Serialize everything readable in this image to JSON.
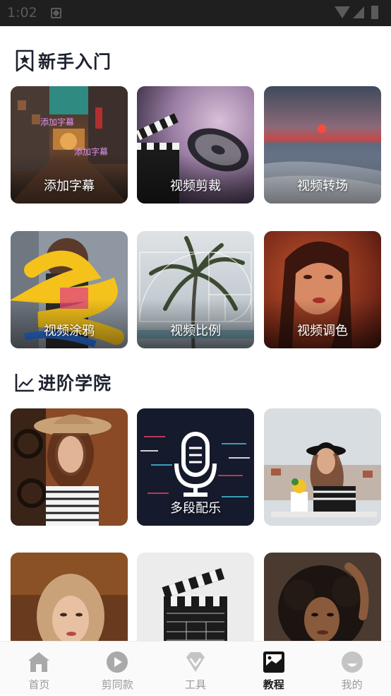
{
  "status_bar": {
    "time": "1:02"
  },
  "sections": {
    "beginner": {
      "title": "新手入门",
      "cards": [
        "添加字幕",
        "视频剪裁",
        "视频转场",
        "视频涂鸦",
        "视频比例",
        "视频调色"
      ],
      "overlay_text": [
        "添加字幕",
        "添加字幕"
      ]
    },
    "advanced": {
      "title": "进阶学院",
      "cards": [
        "",
        "多段配乐",
        "",
        "",
        "",
        ""
      ]
    }
  },
  "bottom_nav": {
    "items": [
      {
        "label": "首页",
        "icon": "home-icon"
      },
      {
        "label": "剪同款",
        "icon": "play-icon"
      },
      {
        "label": "工具",
        "icon": "diamond-icon"
      },
      {
        "label": "教程",
        "icon": "picture-icon"
      },
      {
        "label": "我的",
        "icon": "profile-icon"
      }
    ],
    "active_index": 3
  },
  "colors": {
    "title": "#1e2230",
    "nav_inactive": "#9a9a9a",
    "nav_active": "#1a1a1a",
    "status_bar": "#1f1f1f"
  }
}
